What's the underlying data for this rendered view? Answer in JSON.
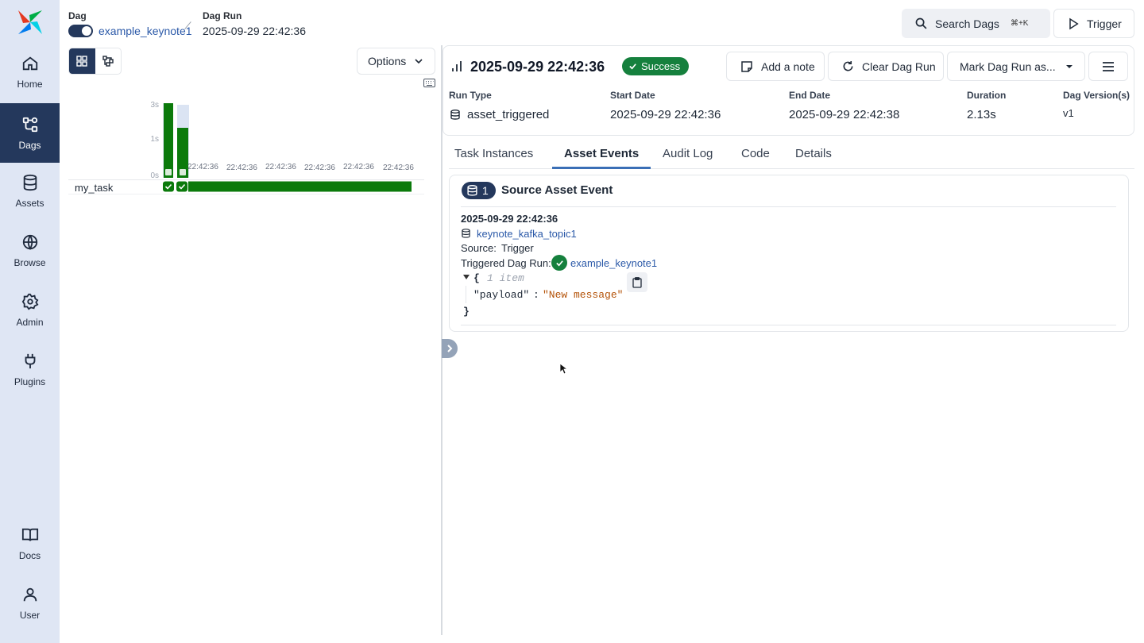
{
  "sidebar": {
    "items": [
      {
        "label": "Home",
        "icon": "home-icon"
      },
      {
        "label": "Dags",
        "icon": "dags-icon",
        "active": true
      },
      {
        "label": "Assets",
        "icon": "database-icon"
      },
      {
        "label": "Browse",
        "icon": "globe-icon"
      },
      {
        "label": "Admin",
        "icon": "gear-icon"
      },
      {
        "label": "Plugins",
        "icon": "plug-icon"
      },
      {
        "label": "Docs",
        "icon": "book-icon"
      },
      {
        "label": "User",
        "icon": "user-icon"
      }
    ]
  },
  "breadcrumb": {
    "dag_label": "Dag",
    "dag_name": "example_keynote1",
    "run_label": "Dag Run",
    "run_value": "2025-09-29 22:42:36"
  },
  "header": {
    "search_label": "Search Dags",
    "search_shortcut": "⌘+K",
    "trigger_label": "Trigger"
  },
  "grid": {
    "options_label": "Options",
    "y_ticks": [
      "3s",
      "1s",
      "0s"
    ],
    "run_labels": [
      "22:42:36",
      "22:42:36",
      "22:42:36",
      "22:42:36",
      "22:42:36",
      "22:42:36"
    ],
    "task_name": "my_task",
    "accent_color": "#0b7a0b"
  },
  "run": {
    "title": "2025-09-29 22:42:36",
    "state": "Success",
    "state_color": "#15803d",
    "actions": {
      "add_note": "Add a note",
      "clear": "Clear Dag Run",
      "mark": "Mark Dag Run as..."
    },
    "meta": [
      {
        "label": "Run Type",
        "value": "asset_triggered"
      },
      {
        "label": "Start Date",
        "value": "2025-09-29 22:42:36"
      },
      {
        "label": "End Date",
        "value": "2025-09-29 22:42:38"
      },
      {
        "label": "Duration",
        "value": "2.13s"
      },
      {
        "label": "Dag Version(s)",
        "value": "v1"
      }
    ]
  },
  "tabs": [
    "Task Instances",
    "Asset Events",
    "Audit Log",
    "Code",
    "Details"
  ],
  "active_tab": "Asset Events",
  "event": {
    "count": "1",
    "title": "Source Asset Event",
    "timestamp": "2025-09-29 22:42:36",
    "asset": "keynote_kafka_topic1",
    "source_label": "Source:",
    "source_value": "Trigger",
    "triggered_label": "Triggered Dag Run:",
    "triggered_link": "example_keynote1",
    "json_open": "{",
    "json_count": "1 item",
    "json_key": "\"payload\"",
    "json_colon": ":",
    "json_value": "\"New message\"",
    "json_close": "}"
  }
}
